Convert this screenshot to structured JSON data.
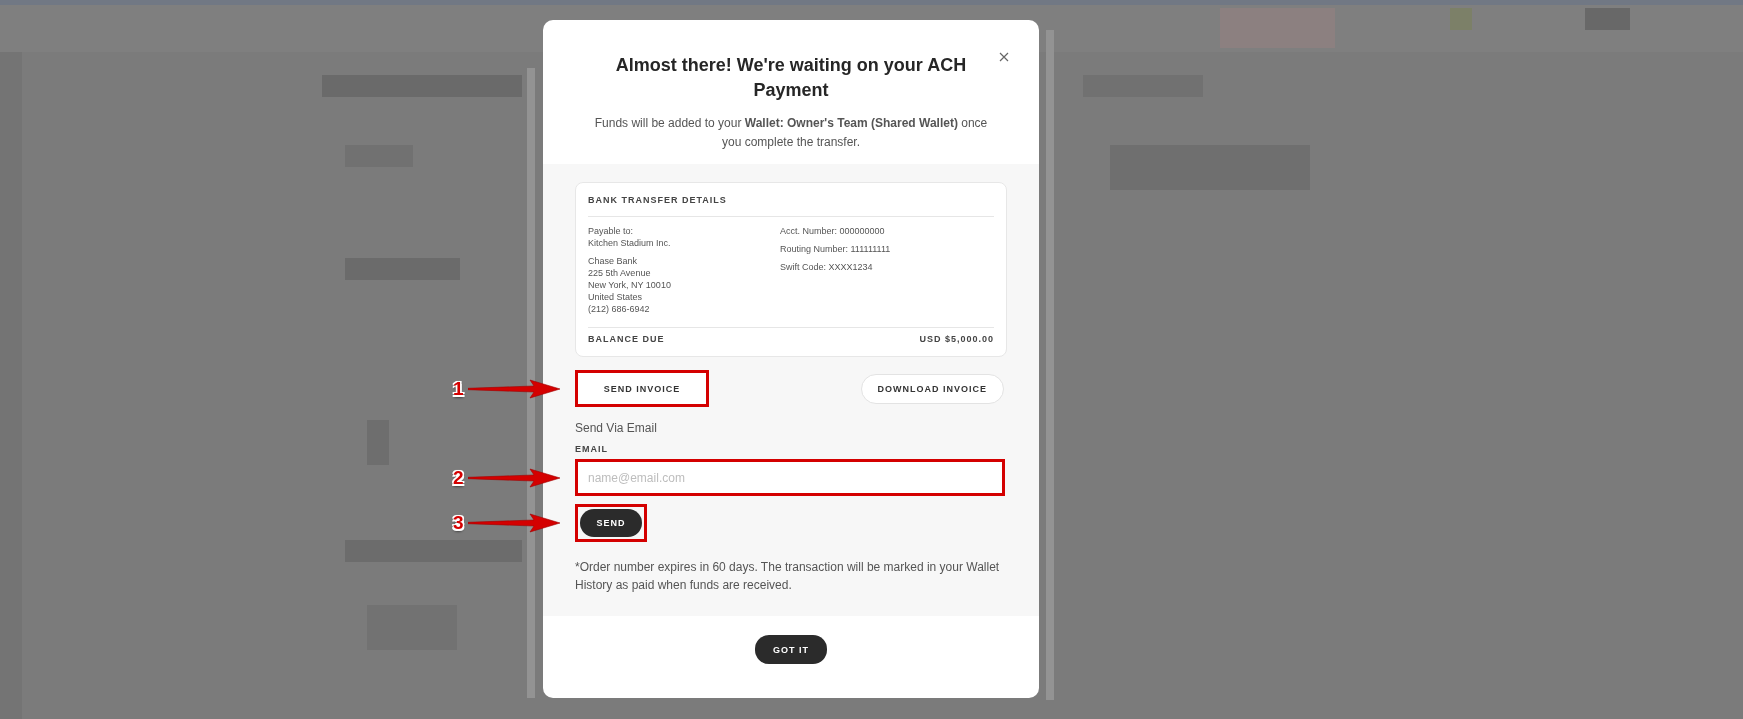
{
  "modal": {
    "title": "Almost there! We're waiting on your ACH Payment",
    "subtitle": "Funds will be added to your **Wallet: Owner's Team (Shared Wallet)** once you complete the transfer.",
    "transfer_details": {
      "heading": "BANK TRANSFER DETAILS",
      "payee_lines": [
        "Payable to:",
        "Kitchen Stadium Inc."
      ],
      "bank_lines": [
        "Chase Bank",
        "225 5th Avenue",
        "New York, NY 10010",
        "United States",
        "(212) 686-6942"
      ],
      "account_fields": [
        "Acct. Number: 000000000",
        "Routing Number: 111111111",
        "Swift Code: XXXX1234"
      ],
      "balance_label": "BALANCE DUE",
      "balance_amount": "USD $5,000.00"
    },
    "actions": [
      {
        "label": "SEND INVOICE",
        "selected": true,
        "highlighted": true
      },
      {
        "label": "DOWNLOAD INVOICE",
        "selected": false,
        "highlighted": false
      }
    ],
    "email_section": {
      "title": "Send Via Email",
      "field_label": "EMAIL",
      "placeholder": "name@email.com",
      "field_highlighted": true,
      "send_button": "SEND",
      "send_highlighted": true
    },
    "note": "*Order number expires in 60 days. The transaction will be marked in your Wallet History as paid when funds are received.",
    "confirm_button": "GOT IT"
  },
  "annotations": [
    {
      "label": "1"
    },
    {
      "label": "2"
    },
    {
      "label": "3"
    }
  ]
}
